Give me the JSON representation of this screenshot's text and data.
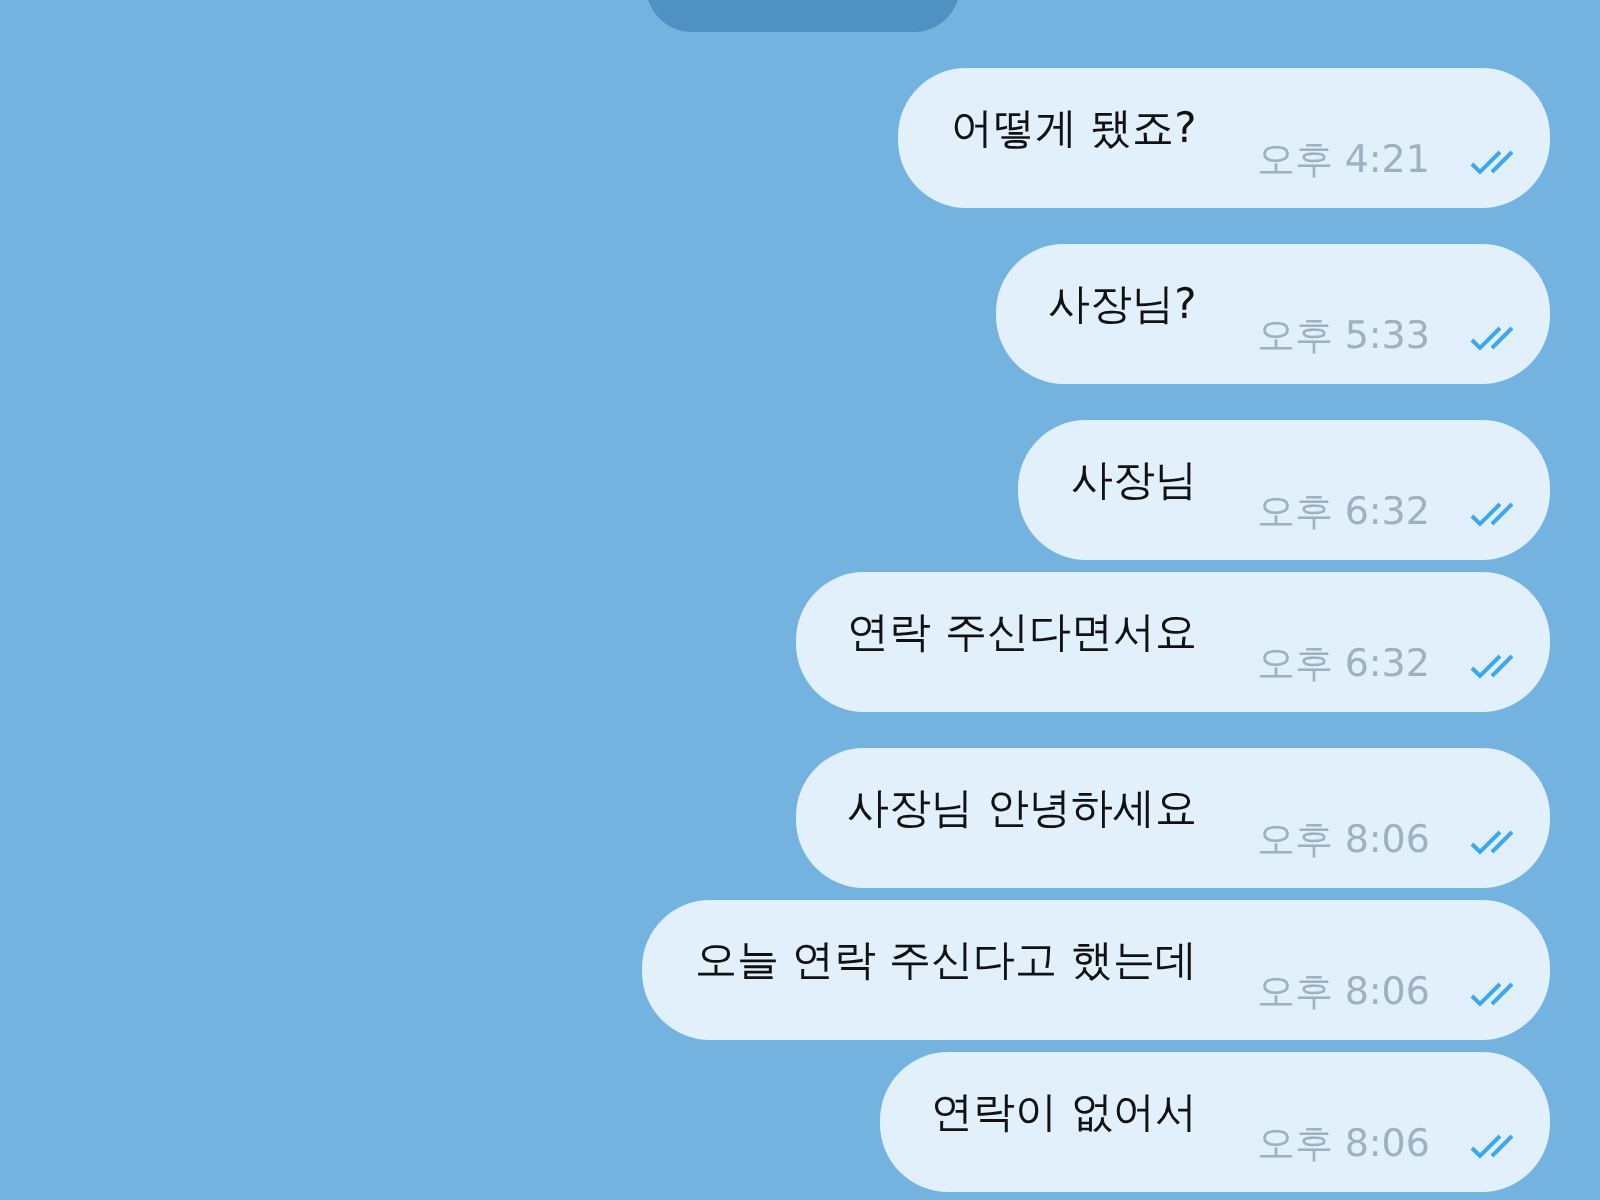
{
  "messages": [
    {
      "text": "어떻게 됐죠?",
      "time": "오후 4:21",
      "read": true,
      "group_start": true
    },
    {
      "text": "사장님?",
      "time": "오후 5:33",
      "read": true,
      "group_start": true
    },
    {
      "text": "사장님",
      "time": "오후 6:32",
      "read": true,
      "group_start": true
    },
    {
      "text": "연락 주신다면서요",
      "time": "오후 6:32",
      "read": true,
      "group_start": false
    },
    {
      "text": "사장님 안녕하세요",
      "time": "오후 8:06",
      "read": true,
      "group_start": true
    },
    {
      "text": "오늘 연락 주신다고 했는데",
      "time": "오후 8:06",
      "read": true,
      "group_start": false
    },
    {
      "text": "연락이 없어서",
      "time": "오후 8:06",
      "read": true,
      "group_start": false
    }
  ]
}
